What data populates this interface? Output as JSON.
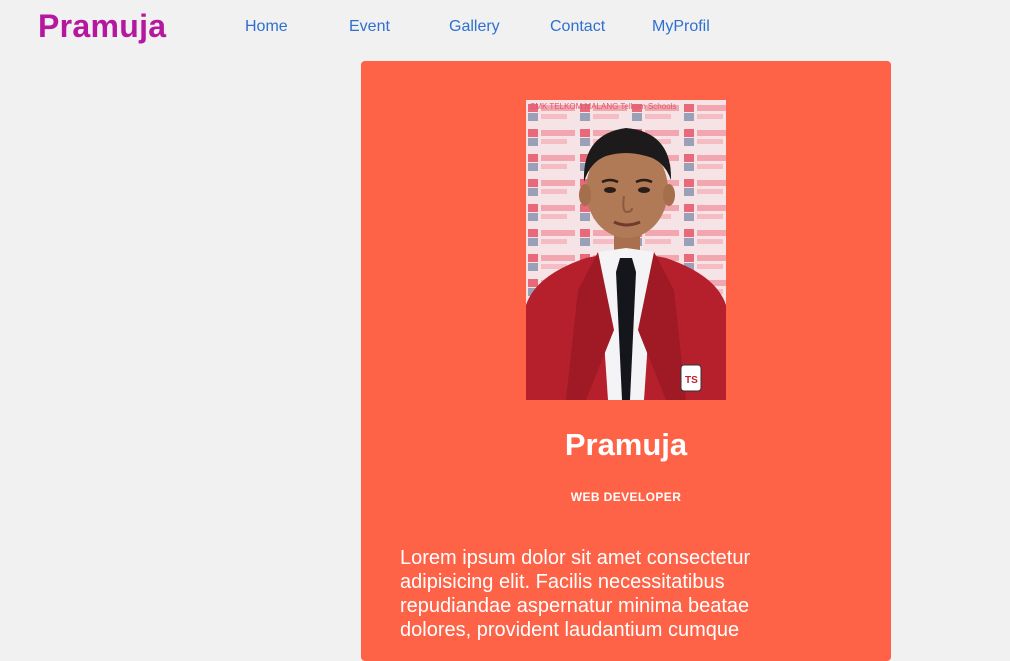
{
  "header": {
    "brand": "Pramuja",
    "nav": [
      "Home",
      "Event",
      "Gallery",
      "Contact",
      "MyProfil"
    ]
  },
  "profile": {
    "name": "Pramuja",
    "role": "WEB DEVELOPER",
    "bio": "Lorem ipsum dolor sit amet consectetur adipisicing elit. Facilis necessitatibus repudiandae aspernatur minima beatae dolores, provident laudantium cumque",
    "photo_backdrop_text": "SMK TELKOM MALANG  Telkom Schools",
    "badge_text": "TS"
  },
  "colors": {
    "brand": "#b5179e",
    "nav_link": "#2f6fd0",
    "card_bg": "#ff6347",
    "page_bg": "#f1f1f1",
    "blazer": "#b5202c"
  }
}
